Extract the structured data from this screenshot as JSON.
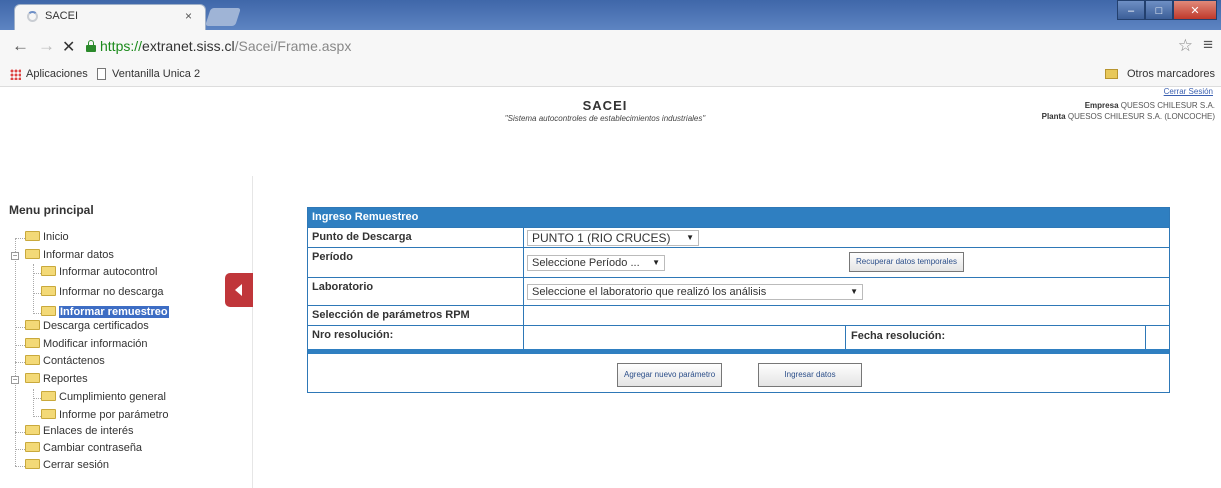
{
  "browser": {
    "tab_title": "SACEI",
    "tab_close": "×",
    "url_proto": "https://",
    "url_host": "extranet.siss.cl",
    "url_path": "/Sacei/Frame.aspx",
    "win_min": "–",
    "win_max": "□",
    "win_close": "✕",
    "bookmarks": {
      "apps": "Aplicaciones",
      "ventanilla": "Ventanilla Unica 2",
      "otros": "Otros marcadores"
    }
  },
  "header": {
    "cerrar_sesion": "Cerrar Sesión",
    "title": "SACEI",
    "subtitle": "\"Sistema autocontroles de establecimientos industriales\"",
    "empresa_label": "Empresa",
    "empresa_value": "QUESOS CHILESUR S.A.",
    "planta_label": "Planta",
    "planta_value": "QUESOS CHILESUR S.A. (LONCOCHE)"
  },
  "menu": {
    "title": "Menu principal",
    "items": [
      {
        "label": "Inicio"
      },
      {
        "label": "Informar datos"
      },
      {
        "label": "Informar autocontrol"
      },
      {
        "label": "Informar no descarga"
      },
      {
        "label": "Informar remuestreo"
      },
      {
        "label": "Descarga certificados"
      },
      {
        "label": "Modificar información"
      },
      {
        "label": "Contáctenos"
      },
      {
        "label": "Reportes"
      },
      {
        "label": "Cumplimiento general"
      },
      {
        "label": "Informe por parámetro"
      },
      {
        "label": "Enlaces de interés"
      },
      {
        "label": "Cambiar contraseña"
      },
      {
        "label": "Cerrar sesión"
      }
    ]
  },
  "form": {
    "title": "Ingreso Remuestreo",
    "punto_label": "Punto de Descarga",
    "punto_value": "PUNTO 1 (RIO CRUCES)",
    "periodo_label": "Período",
    "periodo_value": "Seleccione Período ...",
    "recuperar_button": "Recuperar datos temporales",
    "laboratorio_label": "Laboratorio",
    "laboratorio_value": "Seleccione el laboratorio que realizó los análisis",
    "parametros_label": "Selección de parámetros RPM",
    "nro_resolucion_label": "Nro resolución:",
    "fecha_resolucion_label": "Fecha resolución:",
    "agregar_button": "Agregar nuevo parámetro",
    "ingresar_button": "Ingresar datos"
  }
}
